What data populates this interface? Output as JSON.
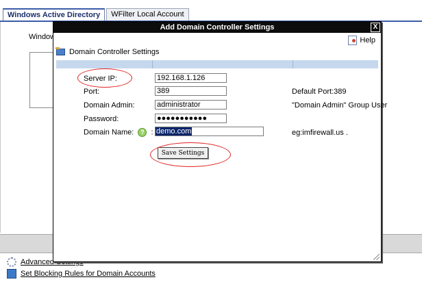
{
  "tabs": [
    {
      "label": "Windows Active Directory",
      "active": true
    },
    {
      "label": "WFilter Local Account",
      "active": false
    }
  ],
  "background": {
    "partial_label": "Window",
    "links": [
      {
        "label": "Advanced Settings",
        "icon": "gear-icon"
      },
      {
        "label": "Set Blocking Rules for Domain Accounts",
        "icon": "monitor-icon"
      }
    ]
  },
  "dialog": {
    "title": "Add Domain Controller Settings",
    "close_label": "X",
    "help_label": "Help",
    "section_title": "Domain Controller Settings",
    "fields": {
      "server_ip": {
        "label": "Server IP:",
        "value": "192.168.1.126"
      },
      "port": {
        "label": "Port:",
        "value": "389",
        "note": "Default Port:389"
      },
      "domain_admin": {
        "label": "Domain Admin:",
        "value": "administrator",
        "note": "\"Domain Admin\" Group User"
      },
      "password": {
        "label": "Password:",
        "value": "●●●●●●●●●●●"
      },
      "domain_name": {
        "label": "Domain Name:",
        "help_glyph": "?",
        "colon": ":",
        "value": "demo.com",
        "note": "eg:imfirewall.us ."
      }
    },
    "save_label": "Save Settings"
  },
  "colors": {
    "titlebar": "#0c0c0c",
    "header_strip": "#c5d8ee",
    "annotation": "#e02020",
    "selection": "#0a246a"
  }
}
